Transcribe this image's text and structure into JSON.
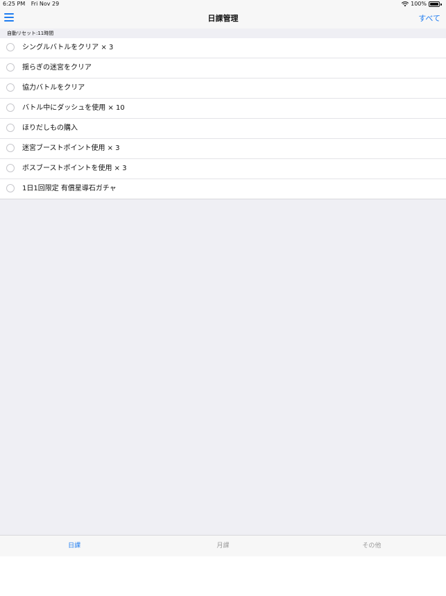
{
  "status": {
    "time": "6:25 PM",
    "date": "Fri Nov 29",
    "battery": "100%"
  },
  "nav": {
    "title": "日課管理",
    "right_label": "すべて",
    "menu_icon": "hamburger-icon"
  },
  "section": {
    "header": "自動リセット:11時間"
  },
  "tasks": [
    {
      "label": "シングルバトルをクリア × 3"
    },
    {
      "label": "揺らぎの迷宮をクリア"
    },
    {
      "label": "協力バトルをクリア"
    },
    {
      "label": "バトル中にダッシュを使用 × 10"
    },
    {
      "label": "ほりだしもの購入"
    },
    {
      "label": "迷宮ブーストポイント使用 × 3"
    },
    {
      "label": "ボスブーストポイントを使用 × 3"
    },
    {
      "label": "1日1回限定 有償星導石ガチャ"
    }
  ],
  "tabs": [
    {
      "label": "日課"
    },
    {
      "label": "月課"
    },
    {
      "label": "その他"
    }
  ],
  "colors": {
    "accent": "#1e7cf0",
    "background": "#efeff4"
  }
}
